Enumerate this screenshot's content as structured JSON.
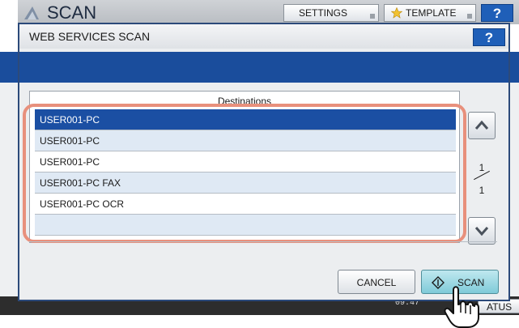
{
  "background": {
    "app_title": "SCAN",
    "settings_label": "SETTINGS",
    "template_label": "TEMPLATE",
    "help_label": "?",
    "time": "09:47",
    "status_label": "ATUS"
  },
  "dialog": {
    "title": "WEB SERVICES SCAN",
    "help_label": "?"
  },
  "list": {
    "header": "Destinations",
    "items": [
      {
        "label": "USER001-PC",
        "selected": true
      },
      {
        "label": "USER001-PC",
        "selected": false
      },
      {
        "label": "USER001-PC",
        "selected": false
      },
      {
        "label": "USER001-PC FAX",
        "selected": false
      },
      {
        "label": "USER001-PC OCR",
        "selected": false
      },
      {
        "label": "",
        "selected": false
      }
    ]
  },
  "pagination": {
    "current": "1",
    "total": "1"
  },
  "actions": {
    "cancel_label": "CANCEL",
    "scan_label": "SCAN"
  },
  "colors": {
    "accent_blue": "#1a4d9c",
    "selected_row": "#1b4fa3",
    "highlight": "#e8907c",
    "scan_button": "#7fcad8"
  },
  "icons": [
    "scan-icon",
    "star-icon",
    "chevron-up-icon",
    "chevron-down-icon",
    "start-diamond-icon",
    "hand-pointer-icon"
  ]
}
